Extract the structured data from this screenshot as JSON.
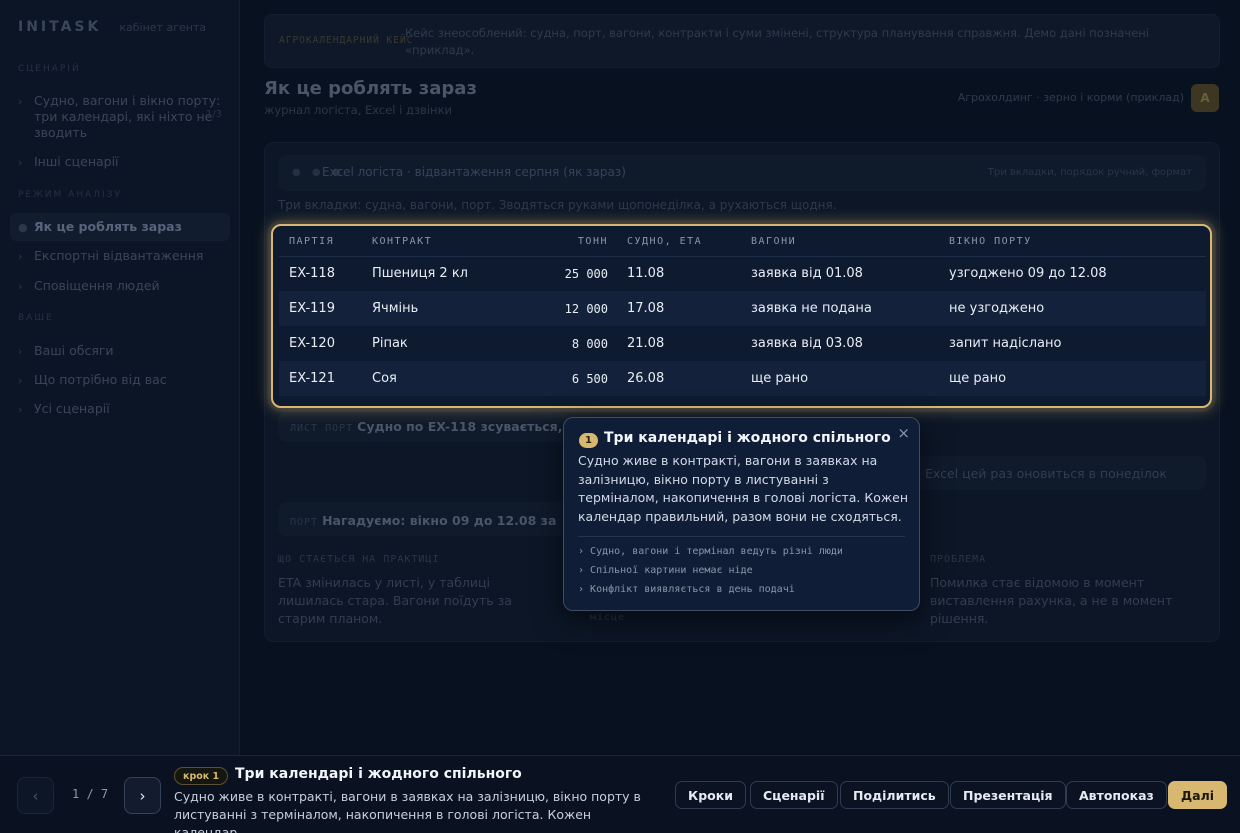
{
  "sidebar": {
    "brand": "INITASK",
    "brand_sub": "кабінет агента",
    "group_scenarios": "СЦЕНАРІЙ",
    "scenario_active": "Судно, вагони і вікно порту: три календарі, які ніхто не зводить",
    "scenario_count": "1/3",
    "scenario_other": "Інші сценарії",
    "group_modes": "РЕЖИМ АНАЛІЗУ",
    "mode_items": [
      "Як це роблять зараз",
      "Експортні відвантаження",
      "Сповіщення людей"
    ],
    "group_next": "ВАШЕ",
    "next_items": [
      "Ваші обсяги",
      "Що потрібно від вас",
      "Усі сценарії"
    ]
  },
  "banner": {
    "label": "АГРОКАЛЕНДАРНИЙ КЕЙС",
    "text": "Кейс знеособлений: судна, порт, вагони, контракти і суми змінені, структура планування справжня. Демо дані позначені «приклад»."
  },
  "page": {
    "title": "Як це роблять зараз",
    "subtitle": "журнал логіста, Excel і дзвінки",
    "top_right": "Агрохолдинг · зерно і корми (приклад)",
    "avatar": "А"
  },
  "card": {
    "dots": "● ● ●",
    "title": "Excel логіста · відвантаження серпня (як зараз)",
    "right": "Три вкладки, порядок ручний, формат",
    "caption": "Три вкладки: судна, вагони, порт. Зводяться руками щопонеділка, а рухаються щодня."
  },
  "table": {
    "headers": [
      "ПАРТІЯ",
      "КОНТРАКТ",
      "ТОНН",
      "СУДНО, ETA",
      "ВАГОНИ",
      "ВІКНО ПОРТУ"
    ],
    "rows": [
      [
        "EX-118",
        "Пшениця 2 кл",
        "25 000",
        "11.08",
        "заявка від 01.08",
        "узгоджено 09 до 12.08"
      ],
      [
        "EX-119",
        "Ячмінь",
        "12 000",
        "17.08",
        "заявка не подана",
        "не узгоджено"
      ],
      [
        "EX-120",
        "Ріпак",
        "8 000",
        "21.08",
        "заявка від 03.08",
        "запит надіслано"
      ],
      [
        "EX-121",
        "Соя",
        "6 500",
        "26.08",
        "ще рано",
        "ще рано"
      ]
    ]
  },
  "dim": {
    "row1_label": "ЛИСТ ПОРТ",
    "row1_text": "Судно по EX-118 зсувається, ETA",
    "row2_right": "Excel цей раз оновиться в понеділок",
    "row3_label": "ПОРТ",
    "row3_text": "Нагадуємо: вікно 09 до 12.08 за",
    "col_left_head": "ЩО СТАЄТЬСЯ НА ПРАКТИЦІ",
    "col_left_text": "ETA змінилась у листі, у таблиці лишилась стара. Вагони поїдуть за старим планом.",
    "col_right_head": "ПРОБЛЕМА",
    "col_right_text": "Помилка стає відомою в момент виставлення рахунка, а не в момент рішення.",
    "footer": "місце"
  },
  "popover": {
    "step": "1",
    "title": "Три календарі і жодного спільного",
    "close": "×",
    "body": "Судно живе в контракті, вагони в заявках на залізницю, вікно порту в листуванні з терміналом, накопичення в голові логіста. Кожен календар правильний, разом вони не сходяться.",
    "bullets": [
      "Судно, вагони і термінал ведуть різні люди",
      "Спільної картини немає ніде",
      "Конфлікт виявляється в день подачі"
    ]
  },
  "bottom": {
    "prev": "‹",
    "next": "›",
    "pager": "1 / 7",
    "step_label": "крок 1",
    "title": "Три календарі і жодного спільного",
    "desc": "Судно живе в контракті, вагони в заявках на залізницю, вікно порту в листуванні з терміналом, накопичення в голові логіста. Кожен календар…",
    "buttons": [
      "Кроки",
      "Сценарії",
      "Поділитись",
      "Презентація",
      "Автопоказ",
      "Далі"
    ]
  },
  "colors": {
    "accent": "#d8b870",
    "background": "#081120",
    "panel": "#0f1d36"
  }
}
